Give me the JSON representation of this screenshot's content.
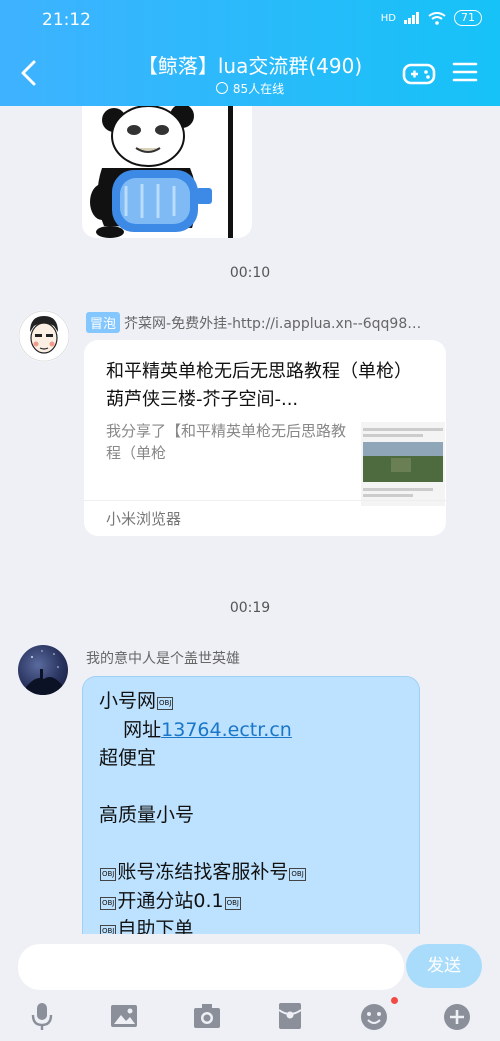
{
  "status": {
    "time": "21:12",
    "network": "HD",
    "battery": "71"
  },
  "header": {
    "title": "【鲸落】lua交流群(490)",
    "subtitle": "85人在线"
  },
  "chat": {
    "timestamps": [
      "00:10",
      "00:19"
    ],
    "msg1": {
      "badge": "冒泡",
      "sender": "芥菜网-免费外挂-http://i.applua.xn--6qq98…",
      "share_title": "和平精英单枪无后无思路教程（单枪） 葫芦侠三楼-芥子空间-...",
      "share_desc": "我分享了【和平精英单枪无后思路教程（单枪",
      "share_source": "小米浏览器"
    },
    "msg2": {
      "sender": "我的意中人是个盖世英雄",
      "obj_label": "OBJ",
      "line1": "小号网",
      "line2_prefix": "    网址",
      "line2_link": "13764.ectr.cn",
      "line3": "超便宜",
      "line5": "高质量小号",
      "line7": "账号冻结找客服补号",
      "line8": "开通分站0.1",
      "line9": "自助下单"
    }
  },
  "input": {
    "placeholder": "",
    "send_label": "发送"
  },
  "toolbar": [
    "microphone-icon",
    "image-icon",
    "camera-icon",
    "red-packet-icon",
    "emoji-icon",
    "plus-icon"
  ]
}
